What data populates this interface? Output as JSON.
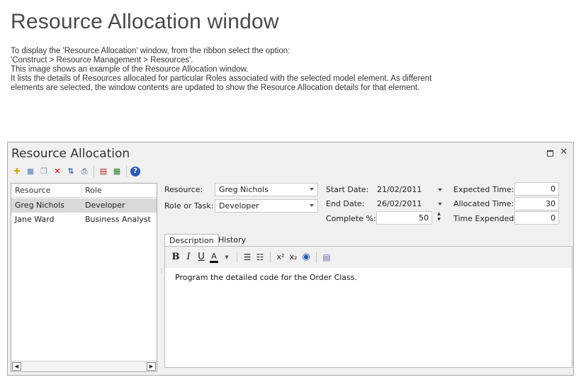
{
  "doc": {
    "title": "Resource Allocation window",
    "lines": [
      "To display the 'Resource Allocation' window, from the ribbon select the option:",
      "'Construct > Resource Management > Resources'.",
      "This image shows an example of the Resource Allocation window.",
      "It lists the details of Resources allocated for particular Roles associated with the selected model element. As different",
      "elements are selected, the window contents are updated to show the Resource Allocation details for that element."
    ]
  },
  "window": {
    "title": "Resource Allocation",
    "maximize_icon": "window-maximize-icon",
    "close_glyph": "✕"
  },
  "toolbar": {
    "buttons": [
      {
        "icon": "new-icon",
        "glyph": "✚",
        "color": "#d9a300"
      },
      {
        "icon": "save-icon",
        "glyph": "■",
        "color": "#8aa4c8"
      },
      {
        "icon": "copy-icon",
        "glyph": "❐",
        "color": "#7d8fa8"
      },
      {
        "icon": "delete-icon",
        "glyph": "✕",
        "color": "#d40000"
      },
      {
        "icon": "sort-icon",
        "glyph": "⇅",
        "color": "#1a4fa0"
      },
      {
        "icon": "print-icon",
        "glyph": "⎙",
        "color": "#2d5aa0"
      },
      {
        "icon": "report-icon",
        "glyph": "▤",
        "color": "#b03030"
      },
      {
        "icon": "chart-icon",
        "glyph": "▦",
        "color": "#2c7a2c"
      },
      {
        "icon": "help-icon",
        "glyph": "?",
        "color": "#2b57b8"
      }
    ]
  },
  "grid": {
    "columns": [
      "Resource",
      "Role"
    ],
    "rows": [
      {
        "resource": "Greg Nichols",
        "role": "Developer",
        "selected": true
      },
      {
        "resource": "Jane Ward",
        "role": "Business Analyst",
        "selected": false
      }
    ],
    "scroll_left": "◀",
    "scroll_right": "▶"
  },
  "form": {
    "resource_label": "Resource:",
    "resource_value": "Greg Nichols",
    "role_label": "Role or Task:",
    "role_value": "Developer",
    "start_label": "Start Date:",
    "start_value": "21/02/2011",
    "end_label": "End Date:",
    "end_value": "26/02/2011",
    "complete_label": "Complete %:",
    "complete_value": "50",
    "expected_label": "Expected Time:",
    "expected_value": "0",
    "allocated_label": "Allocated Time:",
    "allocated_value": "30",
    "expended_label": "Time Expended:",
    "expended_value": "0"
  },
  "tabs": [
    "Description",
    "History"
  ],
  "editor": {
    "tools": {
      "bold": "B",
      "italic": "I",
      "underline": "U",
      "color": "A",
      "bullets": "☰",
      "numbers": "☷",
      "superscript": "x²",
      "subscript": "x₂",
      "hyperlink": "◉",
      "note": "▤"
    },
    "text": "Program the detailed code for the Order Class."
  },
  "splitter_glyph": "⋮"
}
